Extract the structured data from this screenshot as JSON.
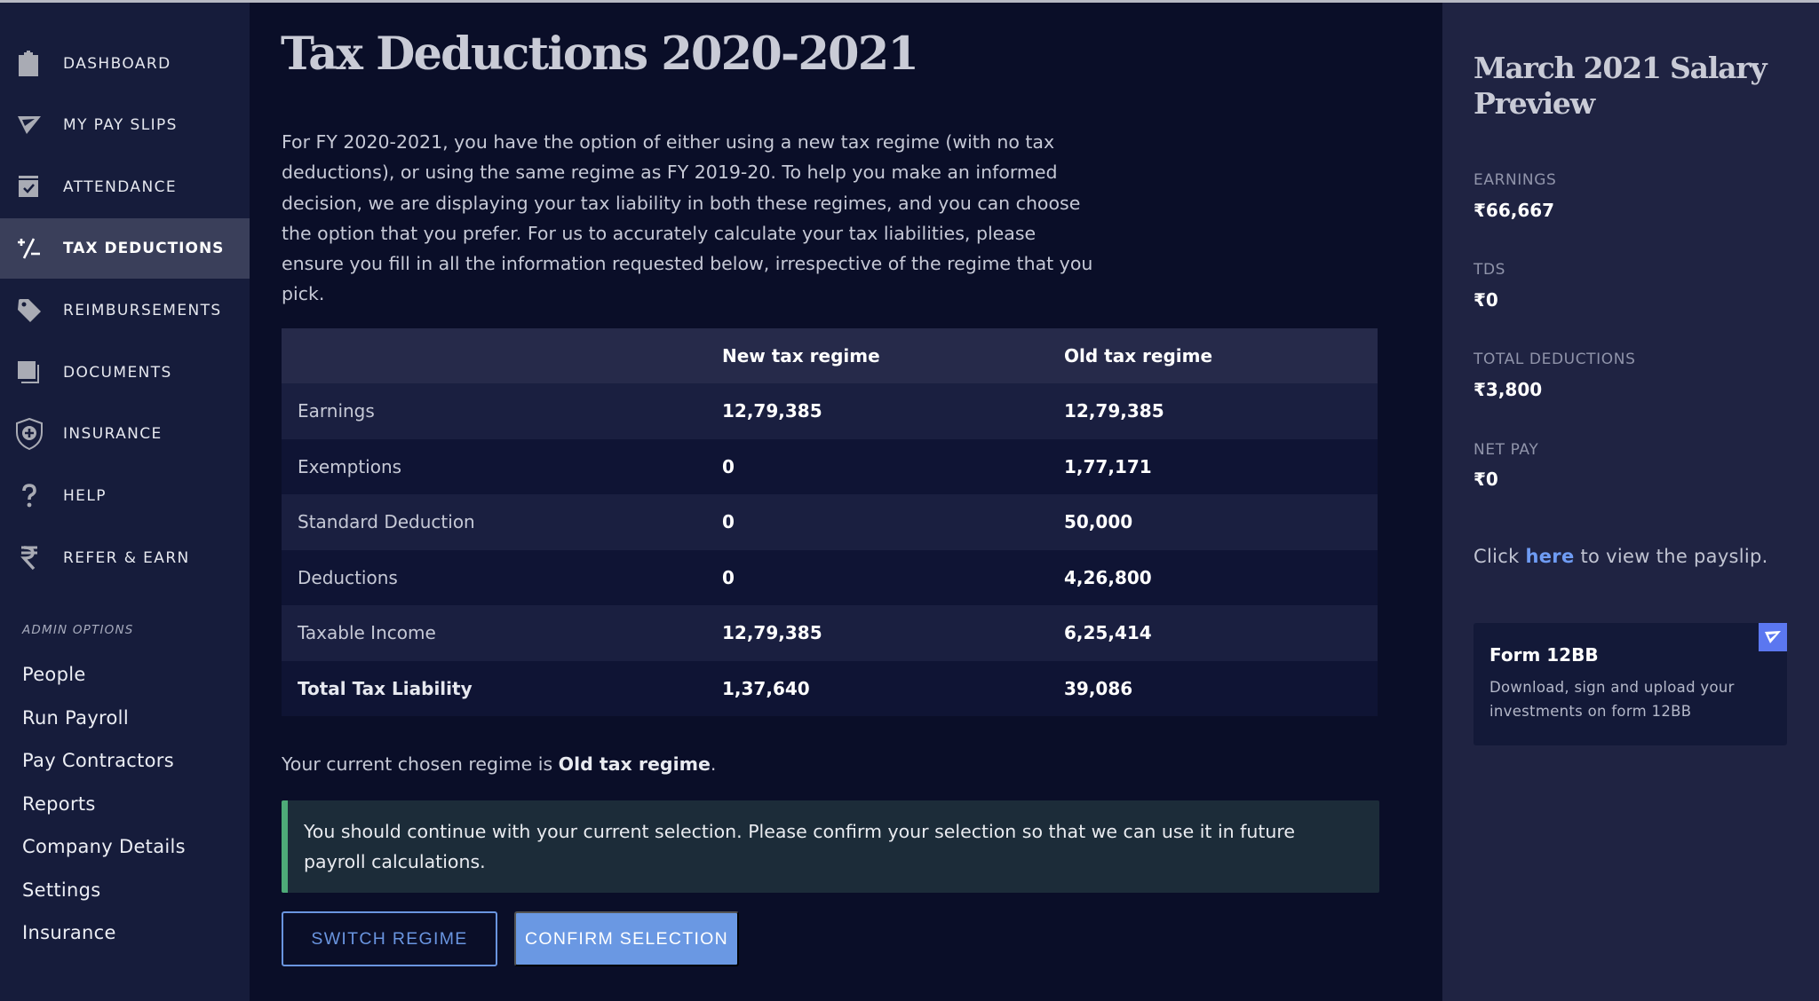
{
  "sidebar": {
    "nav": [
      {
        "label": "DASHBOARD",
        "icon": "clipboard-icon",
        "active": false
      },
      {
        "label": "MY PAY SLIPS",
        "icon": "paper-plane-icon",
        "active": false
      },
      {
        "label": "ATTENDANCE",
        "icon": "calendar-check-icon",
        "active": false
      },
      {
        "label": "TAX DEDUCTIONS",
        "icon": "plus-minus-icon",
        "active": true
      },
      {
        "label": "REIMBURSEMENTS",
        "icon": "tag-icon",
        "active": false
      },
      {
        "label": "DOCUMENTS",
        "icon": "documents-icon",
        "active": false
      },
      {
        "label": "INSURANCE",
        "icon": "shield-plus-icon",
        "active": false
      },
      {
        "label": "HELP",
        "icon": "question-mark-icon",
        "active": false
      },
      {
        "label": "REFER & EARN",
        "icon": "rupee-icon",
        "active": false
      }
    ],
    "admin_heading": "ADMIN OPTIONS",
    "admin_items": [
      "People",
      "Run Payroll",
      "Pay Contractors",
      "Reports",
      "Company Details",
      "Settings",
      "Insurance"
    ]
  },
  "main": {
    "title": "Tax Deductions 2020-2021",
    "intro": "For FY 2020-2021, you have the option of either using a new tax regime (with no tax deductions), or using the same regime as FY 2019-20. To help you make an informed decision, we are displaying your tax liability in both these regimes, and you can choose the option that you prefer. For us to accurately calculate your tax liabilities, please ensure you fill in all the information requested below, irrespective of the regime that you pick.",
    "table": {
      "headers": [
        "",
        "New tax regime",
        "Old tax regime"
      ],
      "rows": [
        [
          "Earnings",
          "12,79,385",
          "12,79,385"
        ],
        [
          "Exemptions",
          "0",
          "1,77,171"
        ],
        [
          "Standard Deduction",
          "0",
          "50,000"
        ],
        [
          "Deductions",
          "0",
          "4,26,800"
        ],
        [
          "Taxable Income",
          "12,79,385",
          "6,25,414"
        ],
        [
          "Total Tax Liability",
          "1,37,640",
          "39,086"
        ]
      ]
    },
    "chosen_prefix": "Your current chosen regime is ",
    "chosen_regime": "Old tax regime",
    "chosen_suffix": ".",
    "alert": "You should continue with your current selection. Please confirm your selection so that we can use it in future payroll calculations.",
    "switch_button": "SWITCH REGIME",
    "confirm_button": "CONFIRM SELECTION"
  },
  "preview": {
    "title": "March 2021 Salary Preview",
    "items": [
      {
        "label": "EARNINGS",
        "value": "₹66,667"
      },
      {
        "label": "TDS",
        "value": "₹0"
      },
      {
        "label": "TOTAL DEDUCTIONS",
        "value": "₹3,800"
      },
      {
        "label": "NET PAY",
        "value": "₹0"
      }
    ],
    "link_prefix": "Click ",
    "link_text": "here",
    "link_suffix": " to view the payslip.",
    "form_card": {
      "title": "Form 12BB",
      "description": "Download, sign and upload your investments on form 12BB",
      "icon": "paper-plane-icon"
    }
  },
  "colors": {
    "accent": "#6a98e3",
    "link": "#6f9cf4",
    "success_border": "#4eaa78",
    "form_icon_bg": "#5b77f0"
  }
}
